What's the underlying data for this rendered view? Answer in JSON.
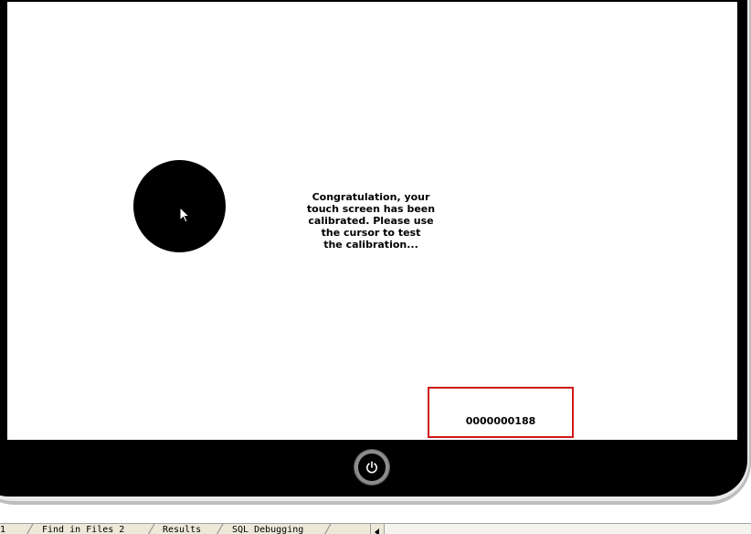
{
  "screen": {
    "message": "Congratulation, your\ntouch screen has been\ncalibrated. Please use\nthe cursor to test\nthe calibration...",
    "counter": "0000000188"
  },
  "icons": {
    "target": "calibration-target-icon",
    "cursor": "mouse-pointer-icon",
    "power": "power-icon"
  },
  "colors": {
    "bezel": "#000000",
    "screen": "#ffffff",
    "highlight_box": "#d01818"
  },
  "tabs": [
    {
      "label": "1"
    },
    {
      "label": "Find in Files 2"
    },
    {
      "label": "Results"
    },
    {
      "label": "SQL Debugging"
    }
  ]
}
